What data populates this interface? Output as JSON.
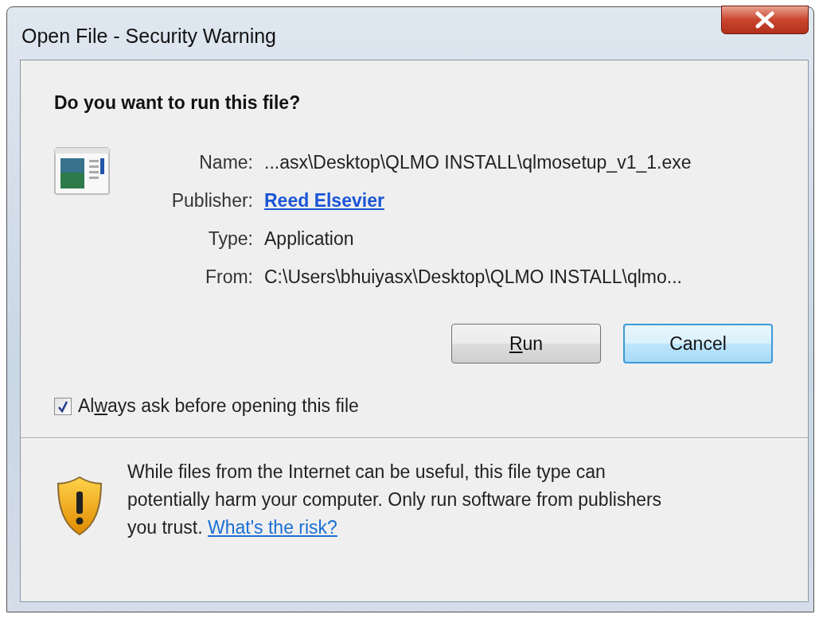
{
  "window": {
    "title": "Open File - Security Warning"
  },
  "heading": "Do you want to run this file?",
  "details": [
    {
      "label": "Name:",
      "value": "...asx\\Desktop\\QLMO INSTALL\\qlmosetup_v1_1.exe",
      "kind": "text"
    },
    {
      "label": "Publisher:",
      "value": "Reed Elsevier",
      "kind": "link"
    },
    {
      "label": "Type:",
      "value": "Application",
      "kind": "text"
    },
    {
      "label": "From:",
      "value": "C:\\Users\\bhuiyasx\\Desktop\\QLMO INSTALL\\qlmo...",
      "kind": "text"
    }
  ],
  "buttons": [
    {
      "access_key": "R",
      "text_after": "un",
      "default": false
    },
    {
      "text_before": "Cancel",
      "default": true
    }
  ],
  "checkbox": {
    "text_before": "Al",
    "access_key": "w",
    "text_after": "ays ask before opening this file",
    "checked": true
  },
  "warning": {
    "text": "While files from the Internet can be useful, this file type can potentially harm your computer. Only run software from publishers you trust.",
    "link": "What's the risk?"
  }
}
